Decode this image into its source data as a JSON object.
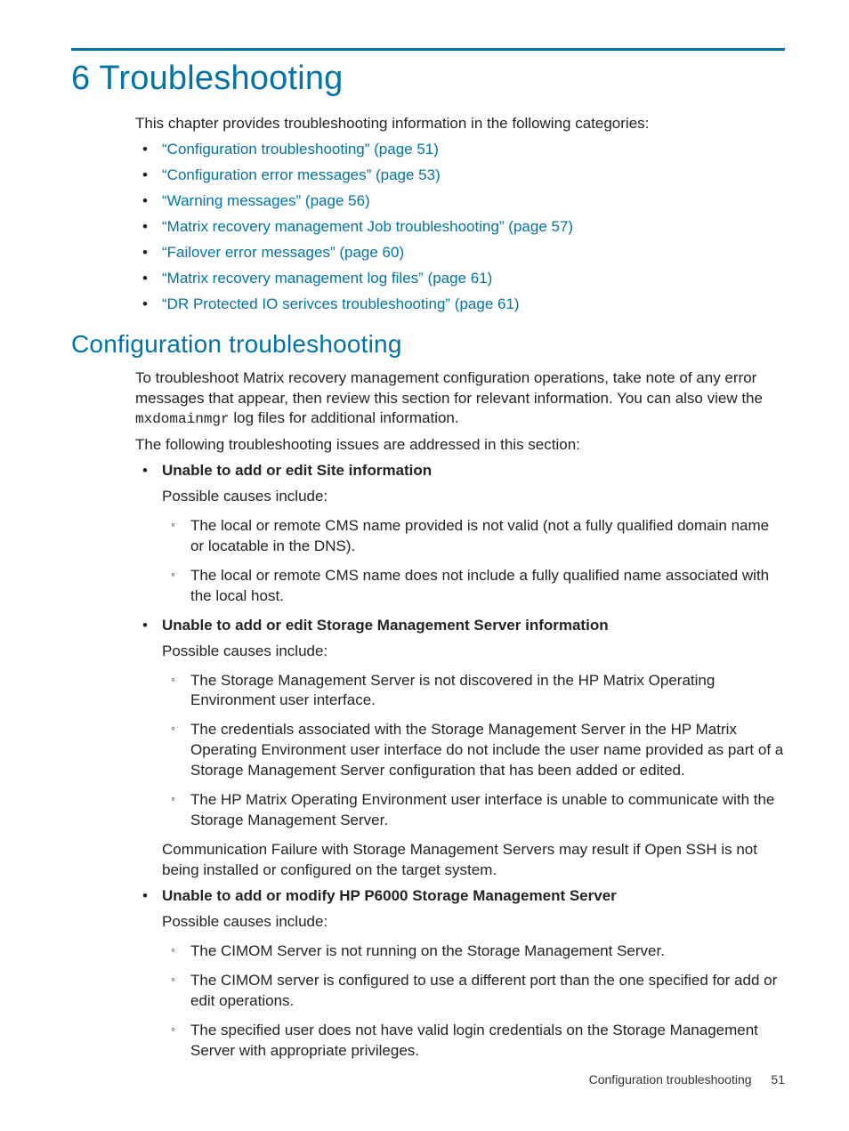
{
  "chapter_title": "6 Troubleshooting",
  "intro": "This chapter provides troubleshooting information in the following categories:",
  "toc_links": [
    "“Configuration troubleshooting” (page 51)",
    "“Configuration error messages” (page 53)",
    "“Warning messages” (page 56)",
    "“Matrix recovery management Job troubleshooting” (page 57)",
    "“Failover error messages” (page 60)",
    "“Matrix recovery management log files” (page 61)",
    "“DR Protected IO serivces troubleshooting” (page 61)"
  ],
  "section_title": "Configuration troubleshooting",
  "section_intro_pre": "To troubleshoot Matrix recovery management configuration operations, take note of any error messages that appear, then review this section for relevant information. You can also view the ",
  "section_intro_code": "mxdomainmgr",
  "section_intro_post": " log files for additional information.",
  "section_lead": "The following troubleshooting issues are addressed in this section:",
  "issues": [
    {
      "title": "Unable to add or edit Site information",
      "causes_label": "Possible causes include:",
      "causes": [
        "The local or remote CMS name provided is not valid (not a fully qualified domain name or locatable in the DNS).",
        "The local or remote CMS name does not include a fully qualified name associated with the local host."
      ],
      "trailer": ""
    },
    {
      "title": "Unable to add or edit Storage Management Server information",
      "causes_label": "Possible causes include:",
      "causes": [
        "The Storage Management Server is not discovered in the HP Matrix Operating Environment user interface.",
        "The credentials associated with the Storage Management Server in the HP Matrix Operating Environment user interface do not include the user name provided as part of a Storage Management Server configuration that has been added or edited.",
        "The HP Matrix Operating Environment user interface is unable to communicate with the Storage Management Server."
      ],
      "trailer": "Communication Failure with Storage Management Servers may result if Open SSH is not being installed or configured on the target system."
    },
    {
      "title": "Unable to add or modify HP P6000 Storage Management Server",
      "causes_label": "Possible causes include:",
      "causes": [
        "The CIMOM Server is not running on the Storage Management Server.",
        "The CIMOM server is configured to use a different port than the one specified for add or edit operations.",
        "The specified user does not have valid login credentials on the Storage Management Server with appropriate privileges."
      ],
      "trailer": ""
    }
  ],
  "footer_label": "Configuration troubleshooting",
  "footer_page": "51"
}
